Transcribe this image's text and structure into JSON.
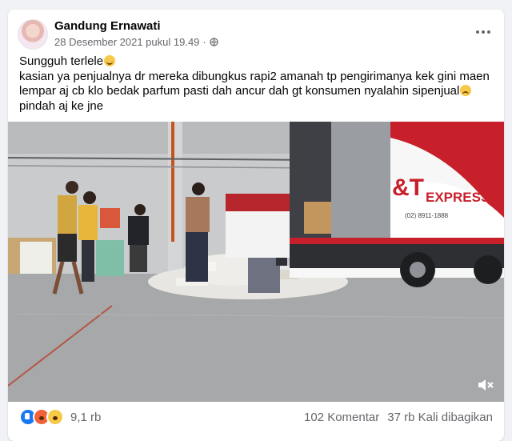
{
  "post": {
    "author": "Gandung Ernawati",
    "timestamp": "28 Desember 2021 pukul 19.49",
    "separator": "·",
    "privacy_icon": "globe-icon",
    "text_lines": [
      "Sungguh terlele",
      "kasian ya penjualnya dr mereka dibungkus rapi2 amanah tp pengirimanya kek gini maen",
      "lempar aj cb klo bedak parfum pasti dah ancur  dah gt konsumen nyalahin sipenjual",
      "pindah aj ke jne"
    ]
  },
  "media": {
    "truck_logo": "&T",
    "truck_brand": "EXPRESS",
    "truck_phone": "(02) 8911-1888"
  },
  "reactions": {
    "icons": [
      "like-icon",
      "angry-icon",
      "wow-icon"
    ],
    "count": "9,1 rb",
    "comments": "102 Komentar",
    "shares": "37 rb Kali dibagikan"
  },
  "colors": {
    "brand_red": "#c8202b",
    "meta_gray": "#65676b",
    "like_blue": "#1877f2"
  }
}
